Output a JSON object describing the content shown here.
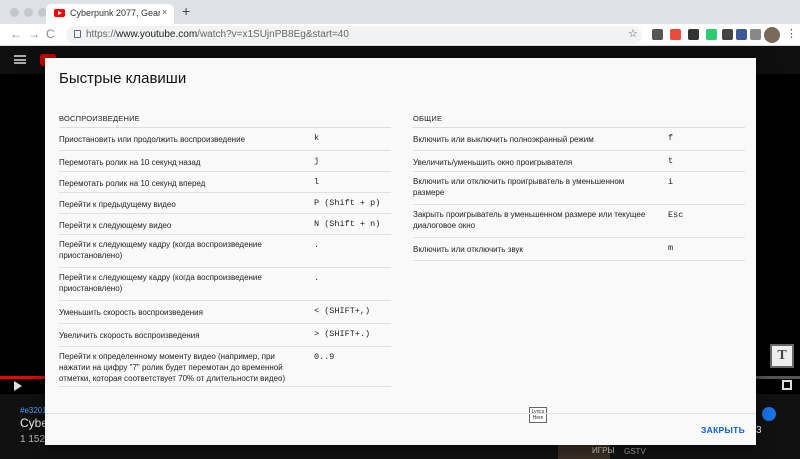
{
  "browser": {
    "tab_title": "Cyberpunk 2077, Gears 5, Вер",
    "tab_close": "×",
    "new_tab": "+",
    "url_prefix": "https://",
    "url_host": "www.youtube.com",
    "url_path": "/watch?v=x1SUjnPB8Eg&start=40",
    "nav_back": "←",
    "nav_forward": "→",
    "nav_reload": "C",
    "star": "☆",
    "menu": "⋮",
    "ext_colors": [
      "#555555",
      "#e74c3c",
      "#333333",
      "#2ecc71",
      "#444444",
      "#3b5998",
      "#888888",
      "#cc0000"
    ]
  },
  "video": {
    "hashtag": "#e3201",
    "title": "Cyber",
    "views": "1 152",
    "right_number": "3",
    "thumb_text": "ИГРЫ",
    "channel": "GSTV",
    "t_badge": "T",
    "progress_fraction": 0.06
  },
  "dialog": {
    "title": "Быстрые клавиши",
    "left_header": "Воспроизведение",
    "right_header": "Общие",
    "close_label": "ЗАКРЫТЬ",
    "lyrics_badge_line1": "Lyrics",
    "lyrics_badge_line2": "Here",
    "left_rows": [
      {
        "label": "Приостановить или продолжить воспроизведение",
        "key": "k"
      },
      {
        "label": "Перемотать ролик на 10 секунд назад",
        "key": "j"
      },
      {
        "label": "Перемотать ролик на 10 секунд вперед",
        "key": "l"
      },
      {
        "label": "Перейти к предыдущему видео",
        "key": "P (Shift + p)"
      },
      {
        "label": "Перейти к следующему видео",
        "key": "N (Shift + n)"
      },
      {
        "label": "Перейти к следующему кадру (когда воспроизведение приостановлено)",
        "key": "."
      },
      {
        "label": "Перейти к следующему кадру (когда воспроизведение приостановлено)",
        "key": "."
      },
      {
        "label": "Уменьшить скорость воспроизведения",
        "key": "< (SHIFT+,)"
      },
      {
        "label": "Увеличить скорость воспроизведения",
        "key": "> (SHIFT+.)"
      },
      {
        "label": "Перейти к определенному моменту видео (например, при нажатии на цифру \"7\" ролик будет перемотан до временной отметки, которая соответствует 70% от длительности видео)",
        "key": "0..9"
      }
    ],
    "right_rows": [
      {
        "label": "Включить или выключить полноэкранный режим",
        "key": "f"
      },
      {
        "label": "Увеличить/уменьшить окно проигрывателя",
        "key": "t"
      },
      {
        "label": "Включить или отключить проигрыватель в уменьшенном размере",
        "key": "i"
      },
      {
        "label": "Закрыть проигрыватель в уменьшенном размере или текущее диалоговое окно",
        "key": "Esc"
      },
      {
        "label": "Включить или отключить звук",
        "key": "m"
      }
    ]
  }
}
